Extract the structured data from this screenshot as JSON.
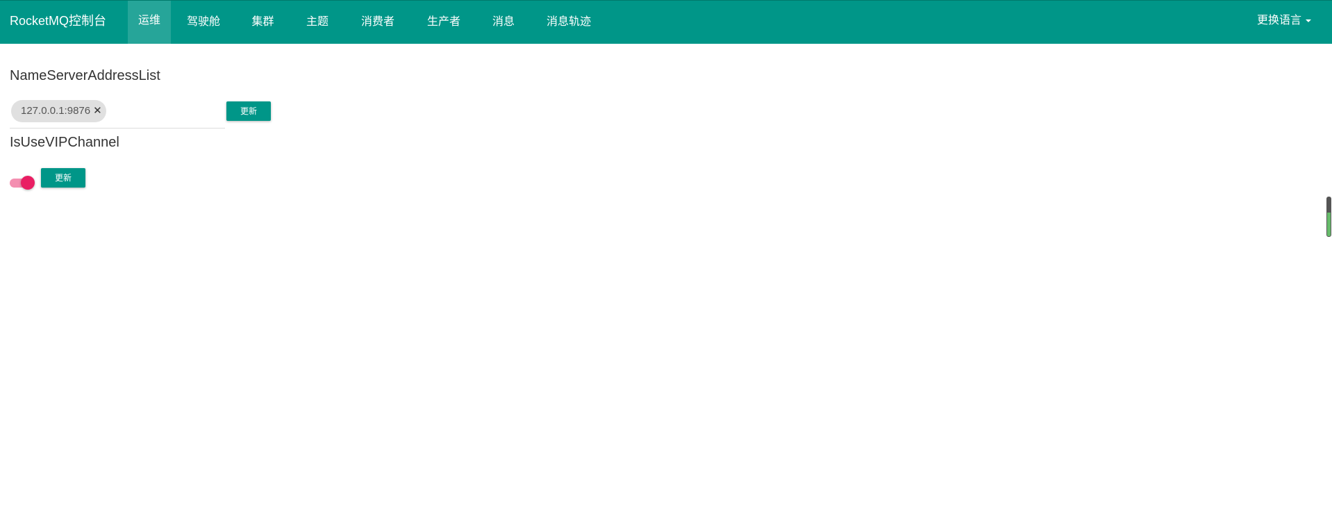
{
  "app": {
    "brand": "RocketMQ控制台"
  },
  "nav": {
    "items": [
      "运维",
      "驾驶舱",
      "集群",
      "主题",
      "消费者",
      "生产者",
      "消息",
      "消息轨迹"
    ],
    "active": "运维"
  },
  "language": {
    "label": "更换语言"
  },
  "nameserver": {
    "label": "NameServerAddressList",
    "chip": "127.0.0.1:9876",
    "update_label": "更新"
  },
  "vip": {
    "label": "IsUseVIPChannel",
    "enabled": true,
    "update_label": "更新"
  },
  "colors": {
    "primary": "#009688",
    "toggle_on": "#e91e63",
    "chip_bg": "#e0e0e0"
  }
}
